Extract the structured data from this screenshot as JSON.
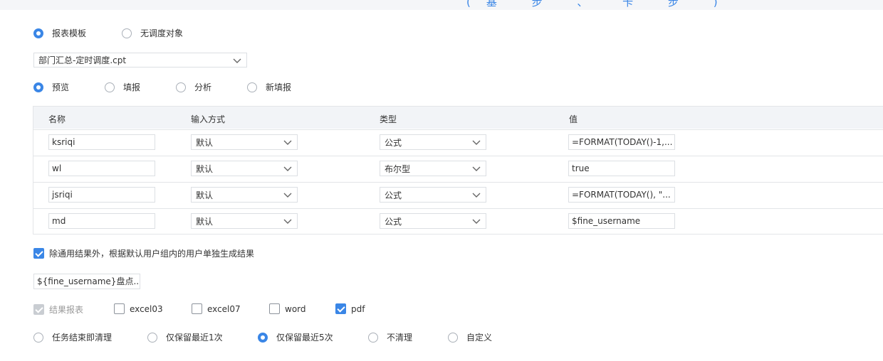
{
  "header": {
    "fragment": "(基 步 、 卡 步 )"
  },
  "source": {
    "options": [
      {
        "label": "报表模板",
        "selected": true
      },
      {
        "label": "无调度对象",
        "selected": false
      }
    ]
  },
  "template_select": {
    "value": "部门汇总-定时调度.cpt"
  },
  "mode": {
    "options": [
      {
        "label": "预览",
        "selected": true
      },
      {
        "label": "填报",
        "selected": false
      },
      {
        "label": "分析",
        "selected": false
      },
      {
        "label": "新填报",
        "selected": false
      }
    ]
  },
  "params_table": {
    "headers": [
      "名称",
      "输入方式",
      "类型",
      "值"
    ],
    "rows": [
      {
        "name": "ksriqi",
        "input_mode": "默认",
        "type": "公式",
        "value": "=FORMAT(TODAY()-1,..."
      },
      {
        "name": "wl",
        "input_mode": "默认",
        "type": "布尔型",
        "value": "true"
      },
      {
        "name": "jsriqi",
        "input_mode": "默认",
        "type": "公式",
        "value": "=FORMAT(TODAY(), \"..."
      },
      {
        "name": "md",
        "input_mode": "默认",
        "type": "公式",
        "value": "$fine_username"
      }
    ]
  },
  "user_group_option": {
    "label": "除通用结果外，根据默认用户组内的用户单独生成结果",
    "checked": true
  },
  "filename_input": {
    "value": "${fine_username}盘点..."
  },
  "formats": {
    "items": [
      {
        "label": "结果报表",
        "checked": true,
        "disabled": true
      },
      {
        "label": "excel03",
        "checked": false
      },
      {
        "label": "excel07",
        "checked": false
      },
      {
        "label": "word",
        "checked": false
      },
      {
        "label": "pdf",
        "checked": true
      }
    ]
  },
  "cleanup": {
    "options": [
      {
        "label": "任务结束即清理",
        "selected": false
      },
      {
        "label": "仅保留最近1次",
        "selected": false
      },
      {
        "label": "仅保留最近5次",
        "selected": true
      },
      {
        "label": "不清理",
        "selected": false
      },
      {
        "label": "自定义",
        "selected": false
      }
    ]
  },
  "colors": {
    "accent": "#3a86e6",
    "border": "#dcdfe3",
    "header_bg": "#f2f4f7"
  },
  "icons": {
    "dropdown": "chevron-down-icon",
    "check": "checkmark-icon"
  }
}
